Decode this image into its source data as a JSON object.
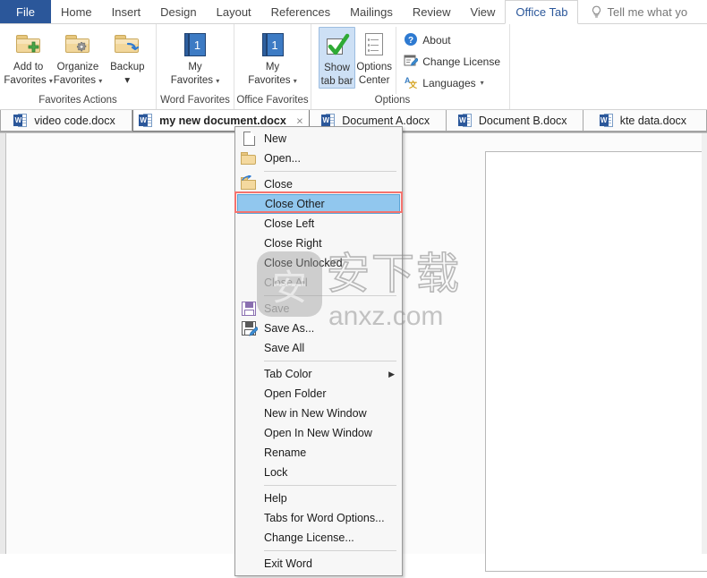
{
  "ribbon_tabs": [
    {
      "label": "File",
      "kind": "file"
    },
    {
      "label": "Home",
      "kind": "normal"
    },
    {
      "label": "Insert",
      "kind": "normal"
    },
    {
      "label": "Design",
      "kind": "normal"
    },
    {
      "label": "Layout",
      "kind": "normal"
    },
    {
      "label": "References",
      "kind": "normal"
    },
    {
      "label": "Mailings",
      "kind": "normal"
    },
    {
      "label": "Review",
      "kind": "normal"
    },
    {
      "label": "View",
      "kind": "normal"
    },
    {
      "label": "Office Tab",
      "kind": "active"
    },
    {
      "label": "Tell me what yo",
      "kind": "tellme"
    }
  ],
  "ribbon": {
    "groups": [
      {
        "label": "Favorites Actions",
        "buttons": [
          {
            "line1": "Add to",
            "line2": "Favorites",
            "icon": "folder-add-icon",
            "dropdown": true
          },
          {
            "line1": "Organize",
            "line2": "Favorites",
            "icon": "folder-gear-icon",
            "dropdown": true
          },
          {
            "line1": "Backup",
            "line2": "",
            "icon": "folder-backup-icon",
            "dropdown": true
          }
        ]
      },
      {
        "label": "Word Favorites",
        "buttons": [
          {
            "line1": "My",
            "line2": "Favorites",
            "icon": "book-1-icon",
            "dropdown": true,
            "badge": "1"
          }
        ]
      },
      {
        "label": "Office Favorites",
        "buttons": [
          {
            "line1": "My",
            "line2": "Favorites",
            "icon": "book-1-icon",
            "dropdown": true,
            "badge": "1"
          }
        ]
      },
      {
        "label": "Options",
        "buttons": [
          {
            "line1": "Show",
            "line2": "tab bar",
            "icon": "green-check-icon",
            "selected": true
          },
          {
            "line1": "Options",
            "line2": "Center",
            "icon": "options-doc-icon"
          }
        ],
        "small_buttons": [
          {
            "label": "About",
            "icon": "question-circle-icon"
          },
          {
            "label": "Change License",
            "icon": "license-pencil-icon"
          },
          {
            "label": "Languages",
            "icon": "languages-icon",
            "dropdown": true
          }
        ]
      }
    ]
  },
  "document_tabs": [
    {
      "label": "video code.docx",
      "active": false
    },
    {
      "label": "my new document.docx",
      "active": true,
      "close": "×"
    },
    {
      "label": "Document A.docx",
      "active": false
    },
    {
      "label": "Document B.docx",
      "active": false
    },
    {
      "label": "kte data.docx",
      "active": false
    }
  ],
  "context_menu": {
    "items": [
      {
        "label": "New",
        "icon": "new-page-icon"
      },
      {
        "label": "Open...",
        "icon": "open-folder-icon"
      },
      {
        "sep": true
      },
      {
        "label": "Close",
        "icon": "close-folder-icon"
      },
      {
        "label": "Close Other",
        "highlighted": true
      },
      {
        "label": "Close Left"
      },
      {
        "label": "Close Right"
      },
      {
        "label": "Close Unlocked"
      },
      {
        "label": "Close All",
        "disabled": true
      },
      {
        "sep": true
      },
      {
        "label": "Save",
        "icon": "save-floppy-icon",
        "disabled": true
      },
      {
        "label": "Save As...",
        "icon": "save-as-floppy-icon"
      },
      {
        "label": "Save All"
      },
      {
        "sep": true
      },
      {
        "label": "Tab Color",
        "submenu": true
      },
      {
        "label": "Open Folder"
      },
      {
        "label": "New in New Window"
      },
      {
        "label": "Open In New Window"
      },
      {
        "label": "Rename"
      },
      {
        "label": "Lock"
      },
      {
        "sep": true
      },
      {
        "label": "Help"
      },
      {
        "label": "Tabs for Word Options..."
      },
      {
        "label": "Change License..."
      },
      {
        "sep": true
      },
      {
        "label": "Exit Word"
      }
    ]
  },
  "watermark": {
    "square_glyph": "安",
    "cjk_text": "安下载",
    "domain": "anxz.com"
  },
  "colors": {
    "file_tab": "#2b579a",
    "active_tab_text": "#2b579a",
    "menu_highlight": "#91c7ee",
    "annotation": "#f4736e",
    "selected_button": "#cde0f5"
  }
}
